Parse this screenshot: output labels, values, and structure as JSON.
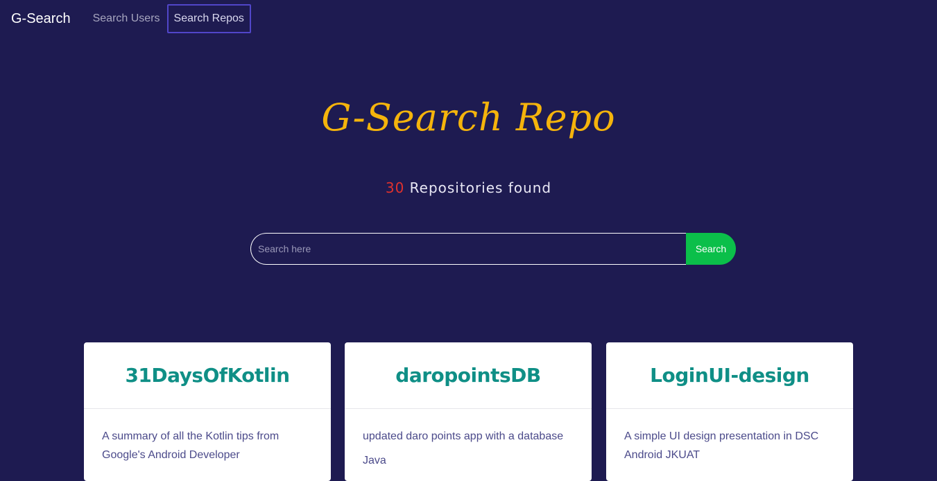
{
  "navbar": {
    "brand": "G-Search",
    "links": [
      {
        "label": "Search Users",
        "active": false
      },
      {
        "label": "Search Repos",
        "active": true
      }
    ]
  },
  "hero": {
    "title": "G-Search Repo",
    "count": "30",
    "count_label": "Repositories found"
  },
  "search": {
    "placeholder": "Search here",
    "value": "",
    "button_label": "Search"
  },
  "repos": [
    {
      "name": "31DaysOfKotlin",
      "description": "A summary of all the Kotlin tips from Google's Android Developer",
      "language": ""
    },
    {
      "name": "daropointsDB",
      "description": "updated daro points app with a database",
      "language": "Java"
    },
    {
      "name": "LoginUI-design",
      "description": "A simple UI design presentation in DSC Android JKUAT",
      "language": ""
    }
  ],
  "colors": {
    "background": "#1e1b51",
    "title": "#f5b40c",
    "count": "#e0312d",
    "search_button": "#0bbf4a",
    "card_title": "#0f8f86",
    "card_text": "#4b4a8a",
    "active_border": "#5146c9"
  }
}
